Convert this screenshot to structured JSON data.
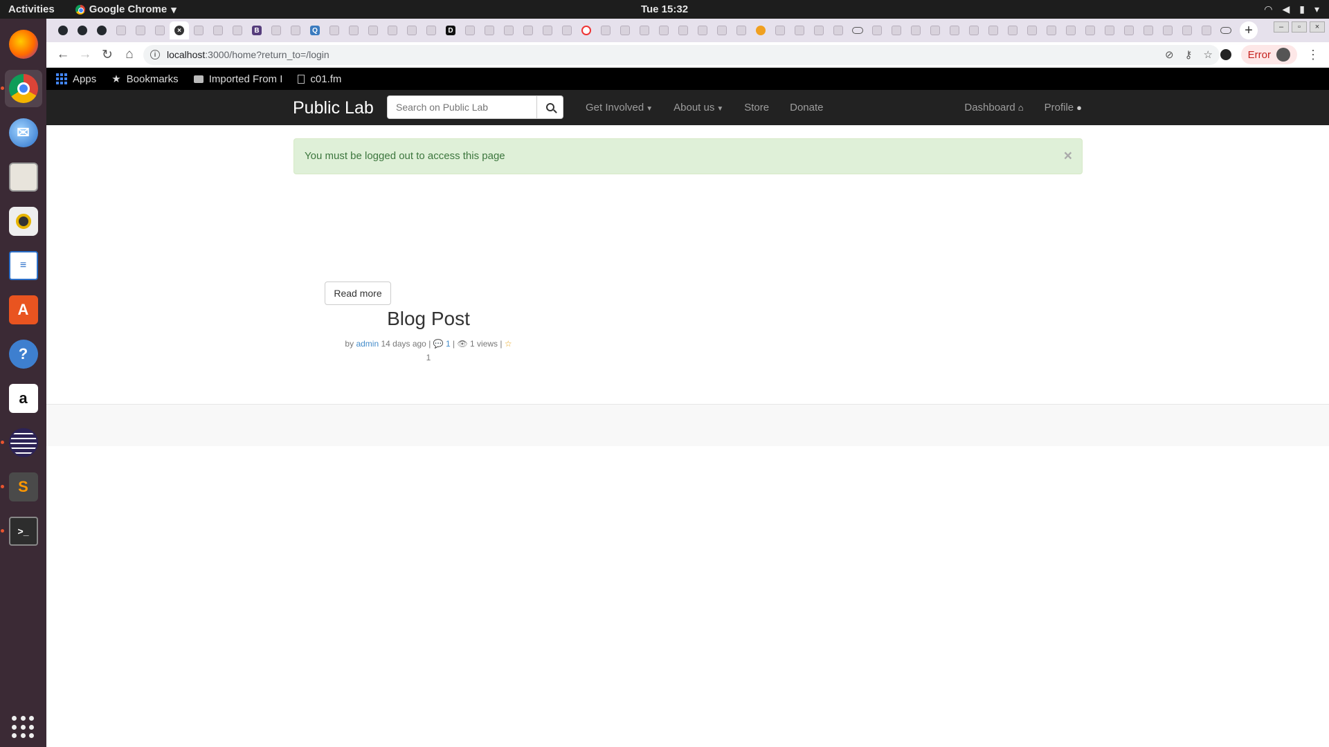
{
  "system": {
    "activities": "Activities",
    "app_name": "Google Chrome",
    "clock": "Tue 15:32"
  },
  "browser": {
    "url_host": "localhost",
    "url_path": ":3000/home?return_to=/login",
    "profile_status": "Error"
  },
  "bookmarks": [
    {
      "label": "Apps"
    },
    {
      "label": "Bookmarks"
    },
    {
      "label": "Imported From I"
    },
    {
      "label": "c01.fm"
    }
  ],
  "site": {
    "brand": "Public Lab",
    "search_placeholder": "Search on Public Lab",
    "nav": {
      "get_involved": "Get Involved",
      "about_us": "About us",
      "store": "Store",
      "donate": "Donate",
      "dashboard": "Dashboard",
      "profile": "Profile"
    }
  },
  "alert": {
    "message": "You must be logged out to access this page",
    "close": "×"
  },
  "post": {
    "title": "Blog Post",
    "by": "by",
    "author": "admin",
    "age": "14 days ago",
    "comments": "1",
    "views": "1 views",
    "likes": "1",
    "read_more": "Read more"
  }
}
